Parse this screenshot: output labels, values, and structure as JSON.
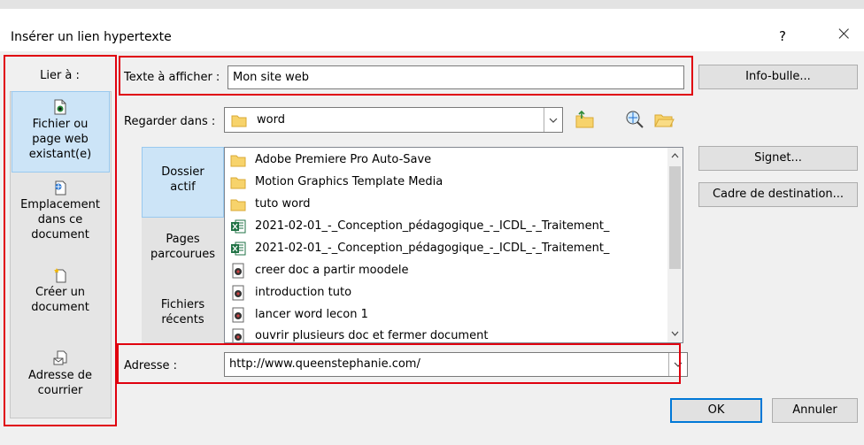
{
  "dialog": {
    "title": "Insérer un lien hypertexte",
    "help": "?",
    "close": "×"
  },
  "sidebar": {
    "label": "Lier à :",
    "items": [
      {
        "l1": "Fichier ou",
        "l2": "page web",
        "l3": "existant(e)",
        "icon": "file-web-icon"
      },
      {
        "l1": "Emplacement",
        "l2": "dans ce",
        "l3": "document",
        "icon": "bookmark-place-icon"
      },
      {
        "l1": "Créer un",
        "l2": "document",
        "l3": "",
        "icon": "new-document-icon"
      },
      {
        "l1": "Adresse de",
        "l2": "courrier",
        "l3": "",
        "icon": "email-address-icon"
      }
    ]
  },
  "text_to_display": {
    "label": "Texte à afficher :",
    "value": "Mon site web"
  },
  "look_in": {
    "label": "Regarder dans :",
    "value": "word"
  },
  "tabs": [
    {
      "l1": "Dossier",
      "l2": "actif"
    },
    {
      "l1": "Pages",
      "l2": "parcourues"
    },
    {
      "l1": "Fichiers",
      "l2": "récents"
    }
  ],
  "files": [
    {
      "name": "Adobe Premiere Pro Auto-Save",
      "type": "folder"
    },
    {
      "name": "Motion Graphics Template Media",
      "type": "folder"
    },
    {
      "name": "tuto word",
      "type": "folder"
    },
    {
      "name": "2021-02-01_-_Conception_pédagogique_-_ICDL_-_Traitement_",
      "type": "excel"
    },
    {
      "name": "2021-02-01_-_Conception_pédagogique_-_ICDL_-_Traitement_",
      "type": "excel"
    },
    {
      "name": "creer doc a partir moodele",
      "type": "video"
    },
    {
      "name": "introduction tuto",
      "type": "video"
    },
    {
      "name": "lancer word lecon 1",
      "type": "video"
    },
    {
      "name": "ouvrir plusieurs doc et fermer document",
      "type": "video"
    }
  ],
  "address": {
    "label": "Adresse :",
    "value": "http://www.queenstephanie.com/"
  },
  "buttons": {
    "screentip": "Info-bulle...",
    "bookmark": "Signet...",
    "target_frame": "Cadre de destination...",
    "ok": "OK",
    "cancel": "Annuler"
  }
}
